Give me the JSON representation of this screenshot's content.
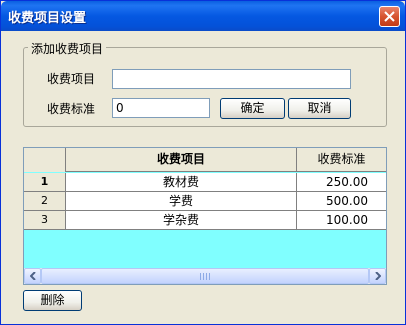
{
  "window": {
    "title": "收费项目设置"
  },
  "group": {
    "legend": "添加收费项目"
  },
  "form": {
    "item_label": "收费项目",
    "item_value": "",
    "standard_label": "收费标准",
    "standard_value": "0",
    "confirm_label": "确定",
    "cancel_label": "取消"
  },
  "grid": {
    "columns": [
      "收费项目",
      "收费标准"
    ],
    "rows": [
      {
        "num": "1",
        "item": "教材费",
        "standard": "250.00"
      },
      {
        "num": "2",
        "item": "学费",
        "standard": "500.00"
      },
      {
        "num": "3",
        "item": "学杂费",
        "standard": "100.00"
      }
    ]
  },
  "footer": {
    "delete_label": "删除"
  },
  "colors": {
    "titlebar": "#0558E2",
    "grid_empty": "#80FFFF",
    "face": "#ECE9D8"
  }
}
